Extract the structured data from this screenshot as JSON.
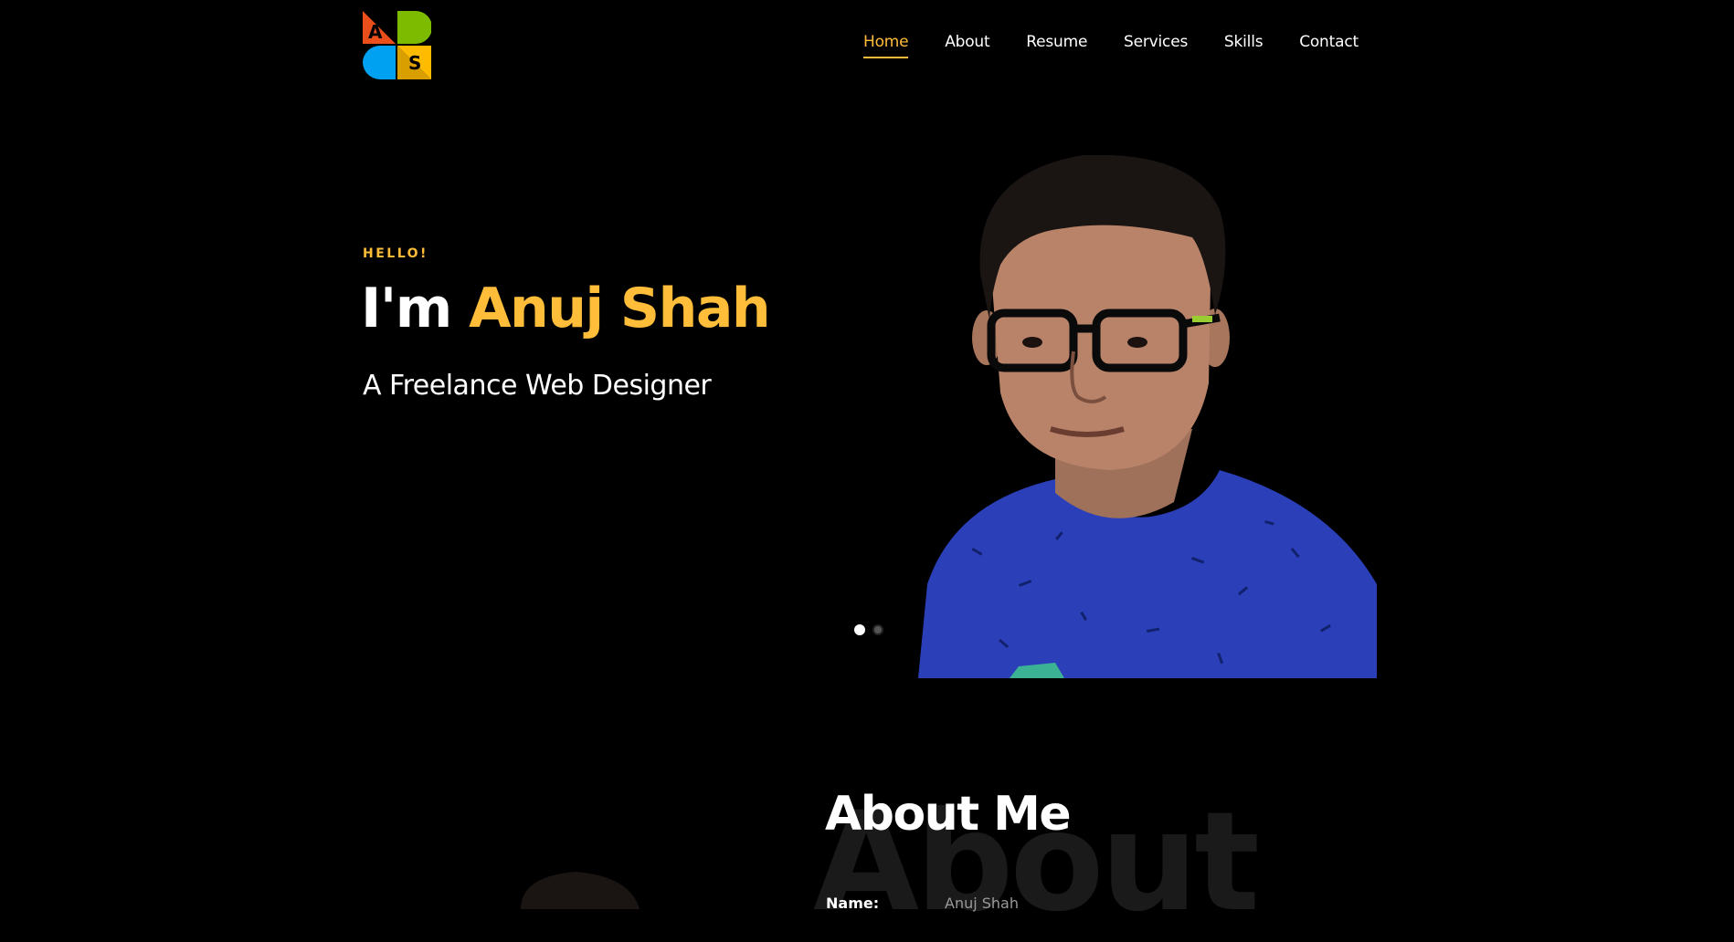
{
  "nav": {
    "items": [
      {
        "label": "Home",
        "active": true
      },
      {
        "label": "About"
      },
      {
        "label": "Resume"
      },
      {
        "label": "Services"
      },
      {
        "label": "Skills"
      },
      {
        "label": "Contact"
      }
    ]
  },
  "logo": {
    "letters": [
      "A",
      "S"
    ]
  },
  "hero": {
    "eyebrow": "HELLO!",
    "title_prefix": "I'm ",
    "title_name": "Anuj Shah",
    "subtitle": "A Freelance Web Designer",
    "slides_total": 2,
    "slide_active": 1
  },
  "about": {
    "bg_word": "About",
    "title": "About Me",
    "details": [
      {
        "label": "Name:",
        "value": "Anuj Shah"
      }
    ]
  },
  "colors": {
    "accent": "#ffbd39",
    "background": "#000000",
    "shirt": "#2a3fb8"
  }
}
